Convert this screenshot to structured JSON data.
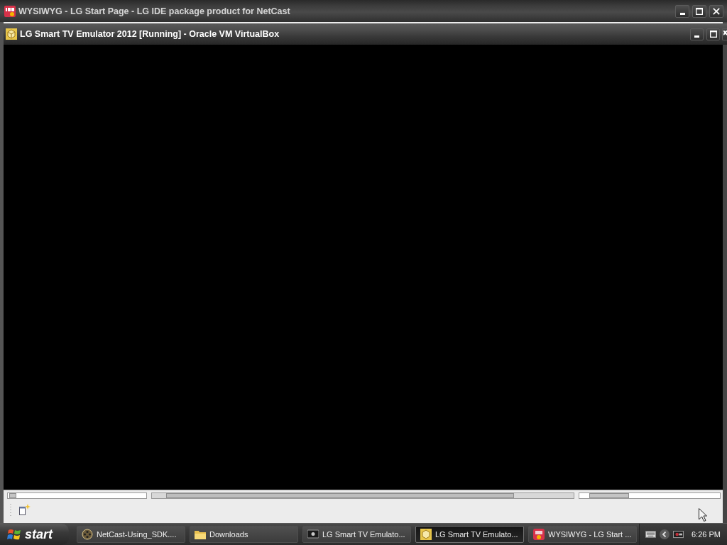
{
  "outer_window": {
    "title": "WYSIWYG - LG Start Page - LG IDE package product for NetCast"
  },
  "vm_window": {
    "title": "LG Smart TV Emulator 2012 [Running] - Oracle VM VirtualBox"
  },
  "taskbar": {
    "start_label": "start",
    "tasks": [
      {
        "kind": "reel",
        "label": "NetCast-Using_SDK....",
        "selected": false
      },
      {
        "kind": "folder",
        "label": "Downloads",
        "selected": false
      },
      {
        "kind": "tv",
        "label": "LG Smart TV Emulato...",
        "selected": false
      },
      {
        "kind": "cube",
        "label": "LG Smart TV Emulato...",
        "selected": true
      },
      {
        "kind": "ide",
        "label": "WYSIWYG - LG Start ...",
        "selected": false
      }
    ],
    "clock": "6:26 PM"
  }
}
